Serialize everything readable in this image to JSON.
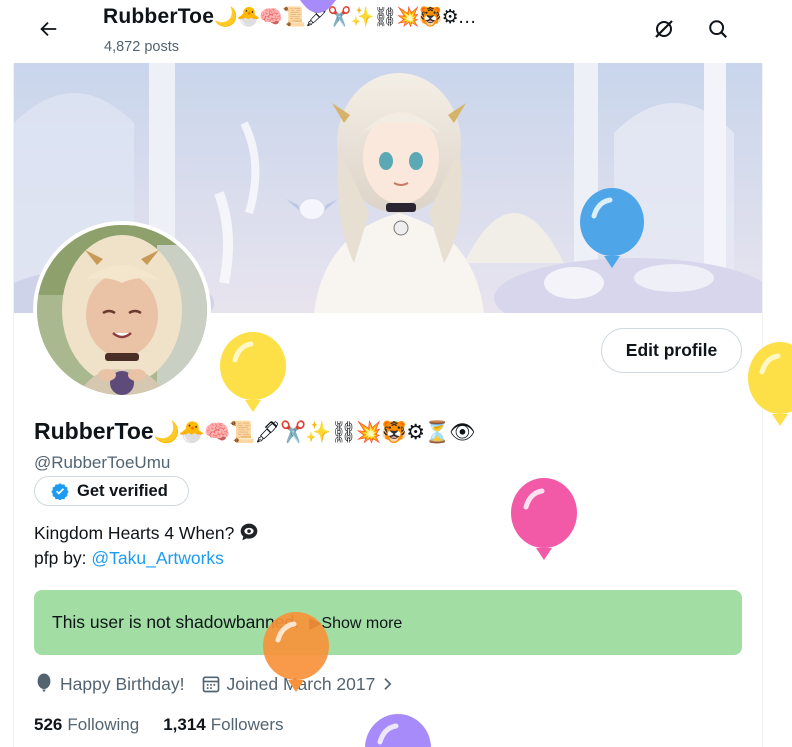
{
  "header": {
    "title": "RubberToe",
    "title_emojis": "🌙🐣🧠📜🖋✂️✨⛓💥🐯⚙…",
    "posts_count": "4,872 posts",
    "back_icon": "arrow-left-icon",
    "grok_icon": "grok-icon",
    "search_icon": "search-icon"
  },
  "profile": {
    "edit_label": "Edit profile",
    "display_name": "RubberToe",
    "name_emojis": "🌙🐣🧠📜🖋✂️✨⛓💥🐯⚙⏳👁",
    "handle": "@RubberToeUmu",
    "verify_label": "Get verified",
    "bio_line1": "Kingdom Hearts 4 When?",
    "bio_line2_prefix": "pfp by: ",
    "bio_link": "@Taku_Artworks",
    "shadowban_text": "This user is not shadowbanned.",
    "show_more_label": "▶Show more",
    "birthday_text": "Happy Birthday!",
    "joined_text": "Joined March 2017",
    "following_count": "526",
    "following_label": "Following",
    "followers_count": "1,314",
    "followers_label": "Followers"
  },
  "colors": {
    "accent": "#1d9bf0",
    "shadowban_bg": "#a2dea4",
    "text_secondary": "#536471",
    "balloon_blue": "#4ea6e8",
    "balloon_yellow": "#fde047",
    "balloon_pink": "#f25aa8",
    "balloon_orange": "#f7913a",
    "balloon_purple": "#a78bfa"
  }
}
